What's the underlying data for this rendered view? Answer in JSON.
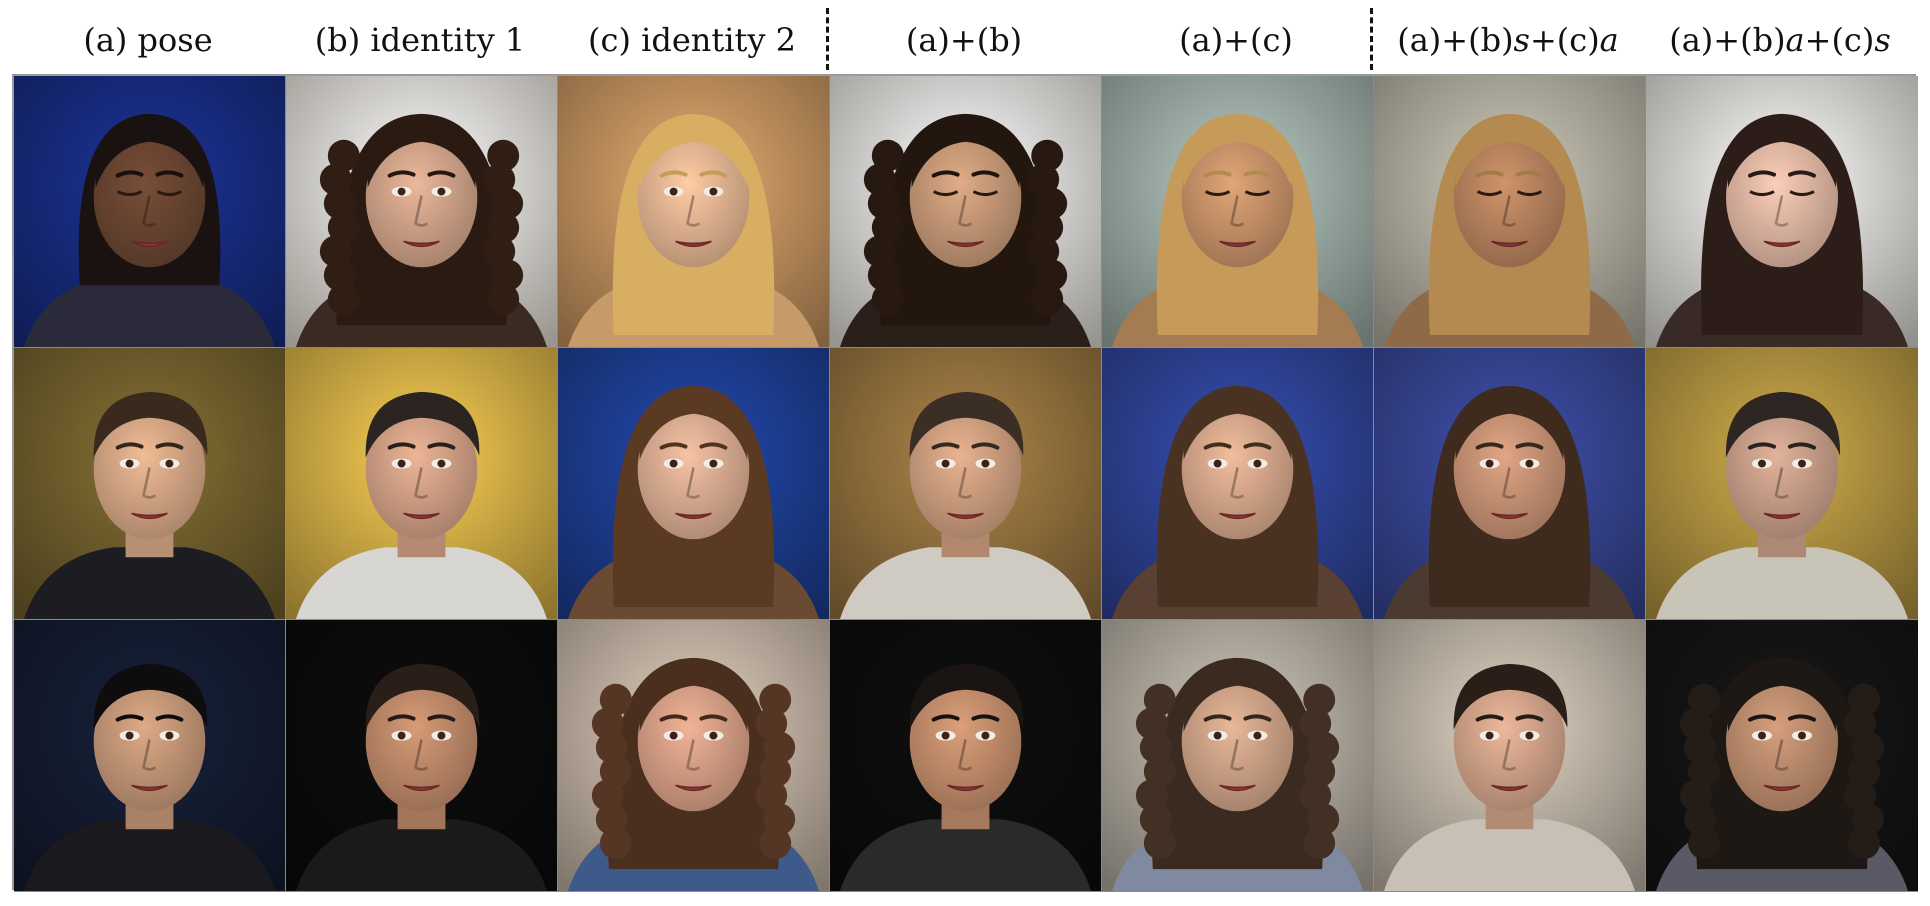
{
  "figure": {
    "columns": [
      {
        "key": "pose",
        "label_parts": [
          {
            "t": "(a) pose",
            "i": false
          }
        ]
      },
      {
        "key": "identity1",
        "label_parts": [
          {
            "t": "(b) identity 1",
            "i": false
          }
        ]
      },
      {
        "key": "identity2",
        "label_parts": [
          {
            "t": "(c) identity 2",
            "i": false
          }
        ]
      },
      {
        "key": "a_plus_b",
        "label_parts": [
          {
            "t": "(a)+(b)",
            "i": false
          }
        ]
      },
      {
        "key": "a_plus_c",
        "label_parts": [
          {
            "t": "(a)+(c)",
            "i": false
          }
        ]
      },
      {
        "key": "mix_bs_ca",
        "label_parts": [
          {
            "t": "(a)+(b)",
            "i": false
          },
          {
            "t": "s",
            "i": true
          },
          {
            "t": "+(c)",
            "i": false
          },
          {
            "t": "a",
            "i": true
          }
        ]
      },
      {
        "key": "mix_ba_cs",
        "label_parts": [
          {
            "t": "(a)+(b)",
            "i": false
          },
          {
            "t": "a",
            "i": true
          },
          {
            "t": "+(c)",
            "i": false
          },
          {
            "t": "s",
            "i": true
          }
        ]
      }
    ],
    "rows": [
      {
        "cells": [
          {
            "bg": "#16297a",
            "skin": "#6b4632",
            "hair": "#1a1210",
            "hairStyle": "tied",
            "eyes": "closed",
            "cloth": "#2a2a3a"
          },
          {
            "bg": "#dcd6cc",
            "skin": "#d2a48a",
            "hair": "#2a1a12",
            "hairStyle": "curly",
            "eyes": "open",
            "cloth": "#3a2a22"
          },
          {
            "bg": "#b98a5a",
            "skin": "#e6b693",
            "hair": "#d7ae62",
            "hairStyle": "wavy",
            "eyes": "open",
            "cloth": "#c79a6a"
          },
          {
            "bg": "#d8d5cf",
            "skin": "#c89a78",
            "hair": "#22160f",
            "hairStyle": "curly",
            "eyes": "closed",
            "cloth": "#2b2019"
          },
          {
            "bg": "#94a39d",
            "skin": "#c9936a",
            "hair": "#c69a58",
            "hairStyle": "wavy",
            "eyes": "closed",
            "cloth": "#a47b52"
          },
          {
            "bg": "#a7a497",
            "skin": "#b9845f",
            "hair": "#b48a50",
            "hairStyle": "wavy",
            "eyes": "closed",
            "cloth": "#8f6a48"
          },
          {
            "bg": "#d2cfca",
            "skin": "#e1b8a4",
            "hair": "#2c1d19",
            "hairStyle": "long",
            "eyes": "closed",
            "cloth": "#3a2a26"
          }
        ]
      },
      {
        "cells": [
          {
            "bg": "#6b5a2a",
            "skin": "#d7a886",
            "hair": "#3a2a1d",
            "hairStyle": "short",
            "eyes": "open",
            "cloth": "#1c1c22"
          },
          {
            "bg": "#c9a642",
            "skin": "#d4a287",
            "hair": "#2b2420",
            "hairStyle": "short",
            "eyes": "open",
            "cloth": "#d8d6d2"
          },
          {
            "bg": "#1b3a8a",
            "skin": "#dcae93",
            "hair": "#5a3a22",
            "hairStyle": "long",
            "eyes": "open",
            "cloth": "#6b4a34"
          },
          {
            "bg": "#8a6b3a",
            "skin": "#d0a080",
            "hair": "#3b2e25",
            "hairStyle": "short",
            "eyes": "open",
            "cloth": "#d0cbc2"
          },
          {
            "bg": "#2c3f8e",
            "skin": "#d8a98c",
            "hair": "#4a3222",
            "hairStyle": "long",
            "eyes": "open",
            "cloth": "#5a4032"
          },
          {
            "bg": "#33418a",
            "skin": "#c99476",
            "hair": "#3e2b1e",
            "hairStyle": "long",
            "eyes": "open",
            "cloth": "#4a3a30"
          },
          {
            "bg": "#a78a3c",
            "skin": "#caa08a",
            "hair": "#2e2622",
            "hairStyle": "short",
            "eyes": "open",
            "cloth": "#c9c4b8"
          }
        ]
      },
      {
        "cells": [
          {
            "bg": "#121a2e",
            "skin": "#c69878",
            "hair": "#0e0c0c",
            "hairStyle": "short",
            "eyes": "open",
            "cloth": "#1a1a1e"
          },
          {
            "bg": "#0a0a0a",
            "skin": "#c08a6a",
            "hair": "#2a1e18",
            "hairStyle": "short",
            "eyes": "open",
            "cloth": "#1c1a18"
          },
          {
            "bg": "#b7a89a",
            "skin": "#d8a087",
            "hair": "#4a2e1e",
            "hairStyle": "curly",
            "eyes": "open",
            "cloth": "#3e5a8a"
          },
          {
            "bg": "#0c0c0c",
            "skin": "#c48e6c",
            "hair": "#1a1412",
            "hairStyle": "short",
            "eyes": "open",
            "cloth": "#2a2a2a"
          },
          {
            "bg": "#a7a196",
            "skin": "#d0a489",
            "hair": "#3a2a20",
            "hairStyle": "curly",
            "eyes": "open",
            "cloth": "#7f8aa0"
          },
          {
            "bg": "#b3aa9d",
            "skin": "#d3a48a",
            "hair": "#2a1f18",
            "hairStyle": "short",
            "eyes": "open",
            "cloth": "#c8c0b4"
          },
          {
            "bg": "#121212",
            "skin": "#bf8e70",
            "hair": "#1e1814",
            "hairStyle": "curly",
            "eyes": "open",
            "cloth": "#5a5a66"
          }
        ]
      }
    ]
  }
}
